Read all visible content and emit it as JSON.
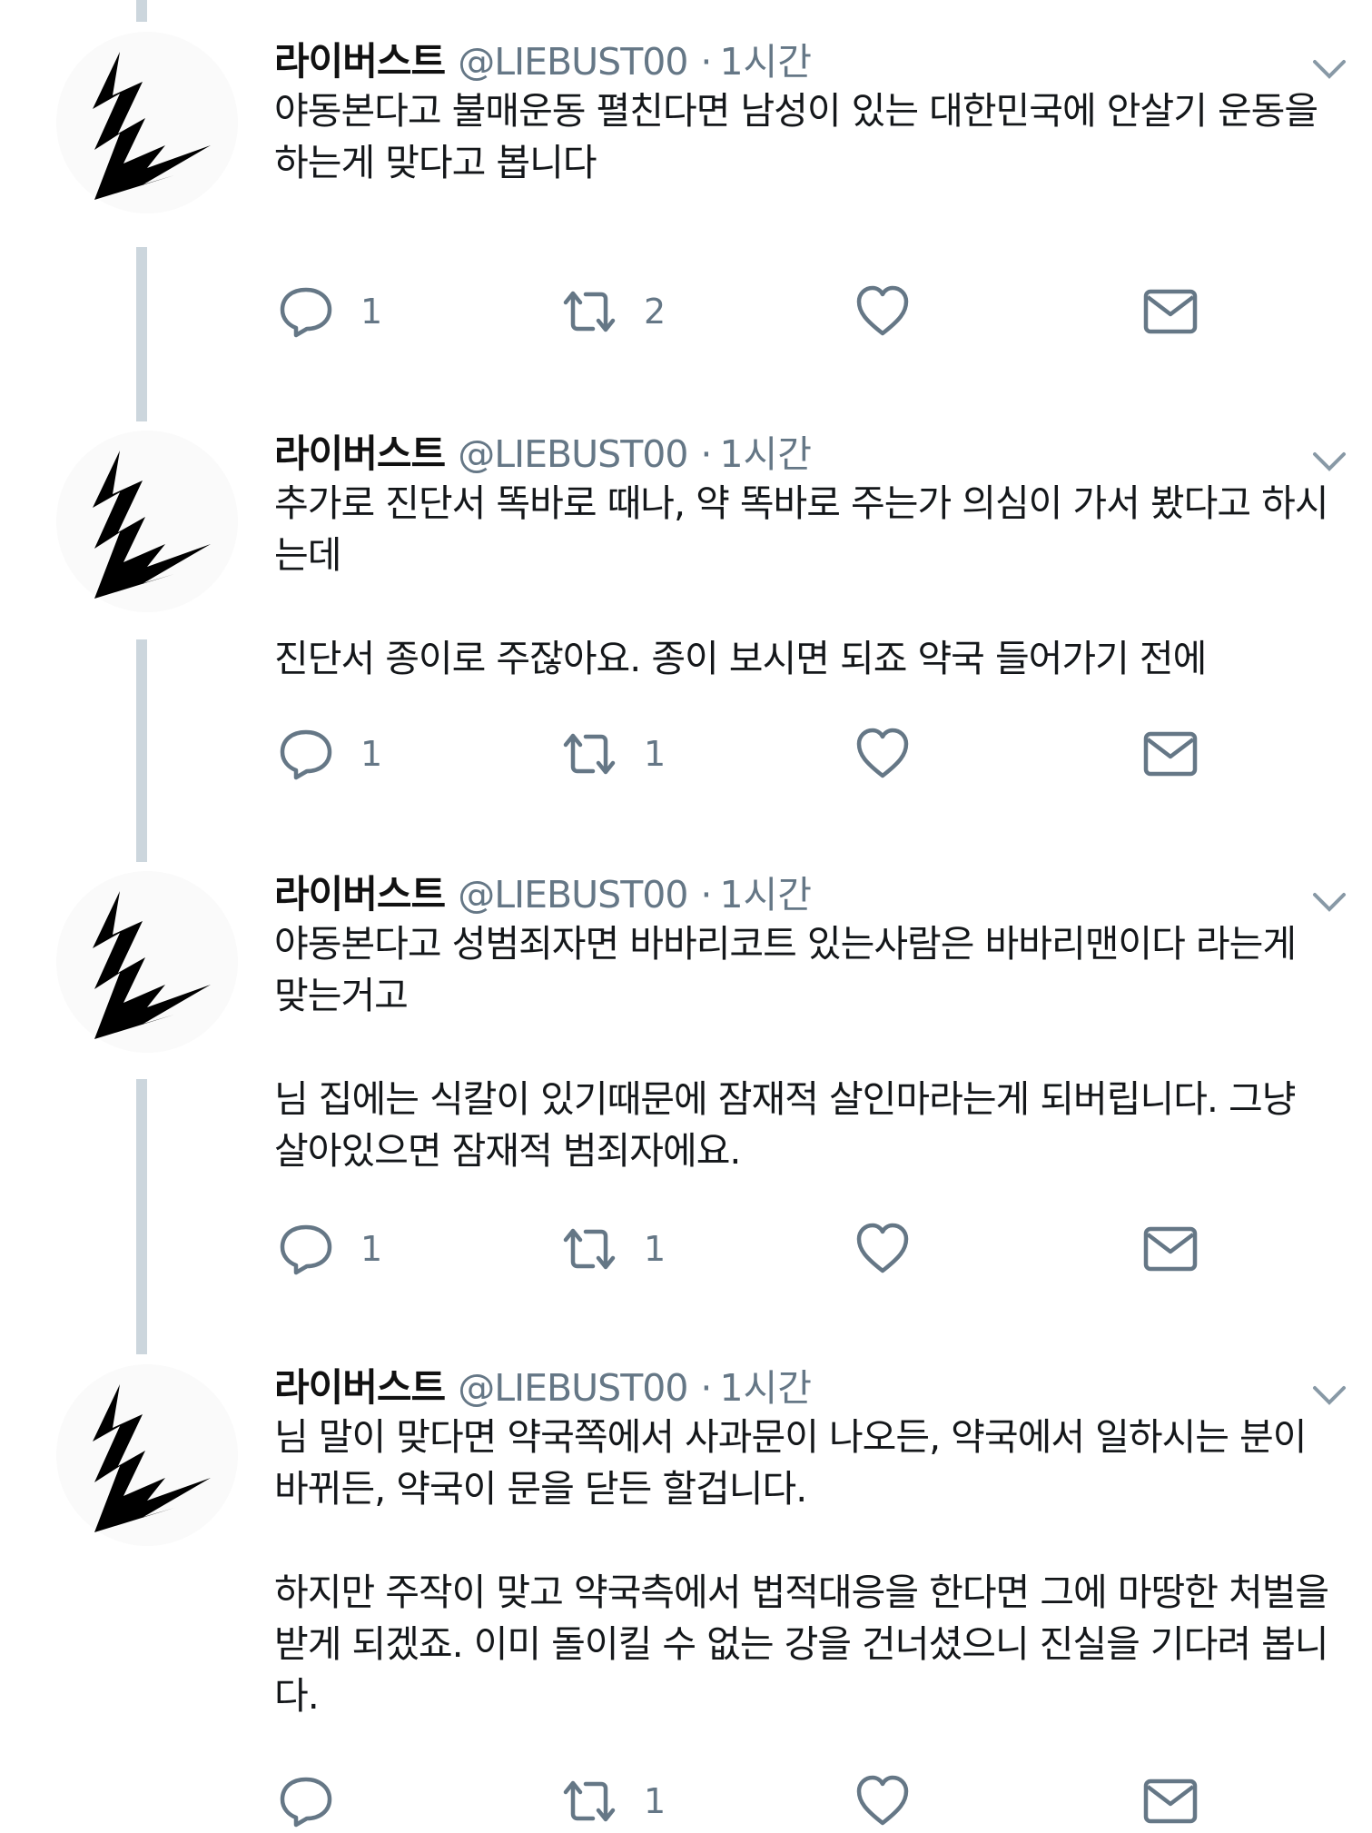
{
  "tweets": [
    {
      "author": {
        "name": "라이버스트",
        "handle": "@LIEBUST00"
      },
      "separator": "·",
      "time": "1시간",
      "paragraphs": [
        "야동본다고 불매운동 펼친다면 남성이 있는 대한민국에 안살기 운동을 하는게 맞다고 봅니다"
      ],
      "replies": "1",
      "retweets": "2",
      "likes": ""
    },
    {
      "author": {
        "name": "라이버스트",
        "handle": "@LIEBUST00"
      },
      "separator": "·",
      "time": "1시간",
      "paragraphs": [
        "추가로 진단서 똑바로 때나, 약 똑바로 주는가 의심이 가서 봤다고 하시는데",
        "진단서 종이로 주잖아요. 종이 보시면 되죠 약국 들어가기 전에"
      ],
      "replies": "1",
      "retweets": "1",
      "likes": ""
    },
    {
      "author": {
        "name": "라이버스트",
        "handle": "@LIEBUST00"
      },
      "separator": "·",
      "time": "1시간",
      "paragraphs": [
        "야동본다고 성범죄자면 바바리코트 있는사람은 바바리맨이다 라는게 맞는거고",
        "님 집에는 식칼이 있기때문에 잠재적 살인마라는게 되버립니다. 그냥 살아있으면 잠재적 범죄자에요."
      ],
      "replies": "1",
      "retweets": "1",
      "likes": ""
    },
    {
      "author": {
        "name": "라이버스트",
        "handle": "@LIEBUST00"
      },
      "separator": "·",
      "time": "1시간",
      "paragraphs": [
        "님 말이 맞다면 약국쪽에서 사과문이 나오든, 약국에서 일하시는 분이 바뀌든, 약국이 문을 닫든 할겁니다.",
        "하지만 주작이 맞고 약국측에서 법적대응을 한다면 그에 마땅한 처벌을 받게 되겠죠. 이미 돌이킬 수 없는 강을 건너셨으니 진실을 기다려 봅니다."
      ],
      "replies": "",
      "retweets": "1",
      "likes": ""
    }
  ],
  "icons": {
    "reply": "speech-bubble",
    "retweet": "two-arrows-loop",
    "like": "heart-outline",
    "dm": "envelope-outline",
    "menu": "chevron-down",
    "avatar": "black-lightning-bolt"
  },
  "colors": {
    "line": "#ccd6dd",
    "icon": "#657786",
    "text": "#14171a"
  }
}
